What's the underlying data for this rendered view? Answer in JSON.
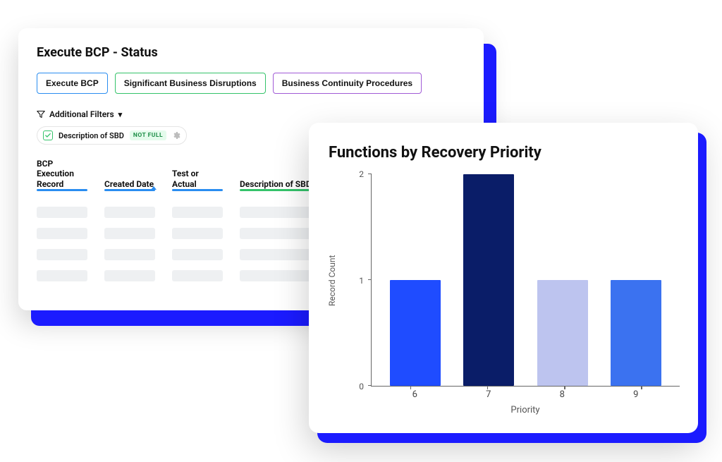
{
  "status_card": {
    "title": "Execute BCP - Status",
    "pills": [
      {
        "label": "Execute BCP",
        "style": "blue"
      },
      {
        "label": "Significant Business Disruptions",
        "style": "green"
      },
      {
        "label": "Business Continuity Procedures",
        "style": "purple"
      }
    ],
    "filters_label": "Additional Filters",
    "chip": {
      "label": "Description of SBD",
      "badge": "NOT FULL"
    },
    "columns": [
      {
        "label": "BCP Execution Record",
        "underline": "blue"
      },
      {
        "label": "Created Date",
        "underline": "blue",
        "sorted": true
      },
      {
        "label": "Test or Actual",
        "underline": "blue"
      },
      {
        "label": "Description of SBD",
        "underline": "green",
        "filter_icon": true
      }
    ],
    "placeholder_rows": 4
  },
  "chart_data": {
    "type": "bar",
    "title": "Functions by Recovery Priority",
    "xlabel": "Priority",
    "ylabel": "Record Count",
    "categories": [
      "6",
      "7",
      "8",
      "9"
    ],
    "values": [
      1,
      2,
      1,
      1
    ],
    "colors": [
      "#1f4cff",
      "#0a1d68",
      "#bdc4ef",
      "#3b72f0"
    ],
    "ylim": [
      0,
      2
    ],
    "yticks": [
      0,
      1,
      2
    ]
  }
}
